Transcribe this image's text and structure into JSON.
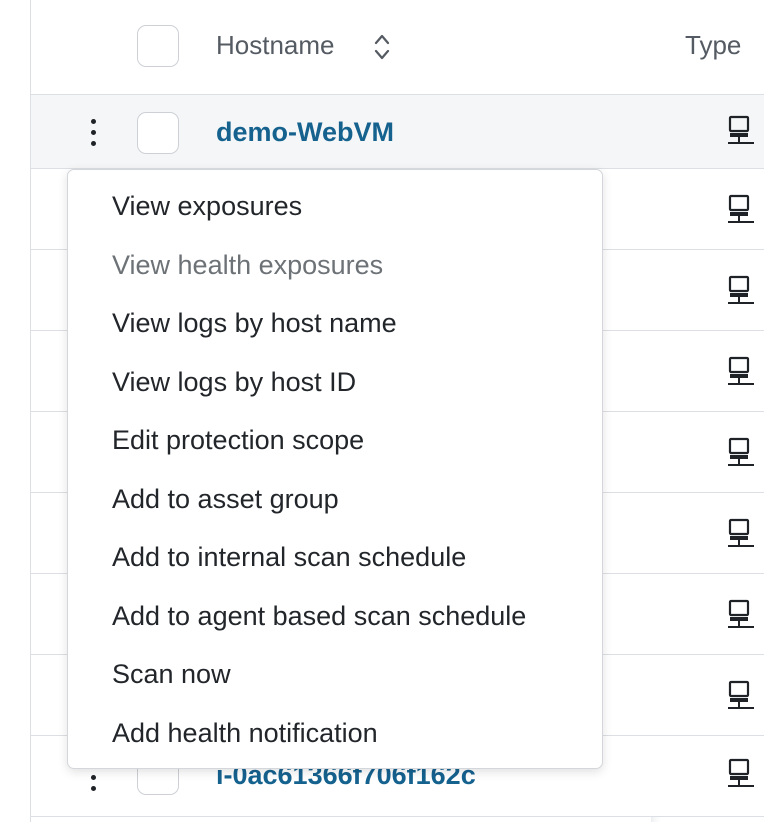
{
  "table": {
    "columns": {
      "hostname": "Hostname",
      "type": "Type"
    },
    "rows": [
      {
        "hostname": "demo-WebVM",
        "type_icon": "computer-icon"
      },
      {
        "hostname": "",
        "type_icon": "computer-icon"
      },
      {
        "hostname": "",
        "type_icon": "computer-icon"
      },
      {
        "hostname": "",
        "type_icon": "computer-icon"
      },
      {
        "hostname": "",
        "type_icon": "computer-icon"
      },
      {
        "hostname": "",
        "type_icon": "computer-icon"
      },
      {
        "hostname": "",
        "type_icon": "computer-icon"
      },
      {
        "hostname": "",
        "type_icon": "computer-icon"
      },
      {
        "hostname": "i-0ac61366f706f162c",
        "type_icon": "computer-icon"
      }
    ]
  },
  "context_menu": {
    "items": [
      {
        "label": "View exposures",
        "disabled": false
      },
      {
        "label": "View health exposures",
        "disabled": true
      },
      {
        "label": "View logs by host name",
        "disabled": false
      },
      {
        "label": "View logs by host ID",
        "disabled": false
      },
      {
        "label": "Edit protection scope",
        "disabled": false
      },
      {
        "label": "Add to asset group",
        "disabled": false
      },
      {
        "label": "Add to internal scan schedule",
        "disabled": false
      },
      {
        "label": "Add to agent based scan schedule",
        "disabled": false
      },
      {
        "label": "Scan now",
        "disabled": false
      },
      {
        "label": "Add health notification",
        "disabled": false
      }
    ]
  },
  "colors": {
    "link": "#15628f",
    "disabled_text": "#6d7277",
    "row_hover": "#f5f6f7",
    "border": "#dcdfe3"
  }
}
